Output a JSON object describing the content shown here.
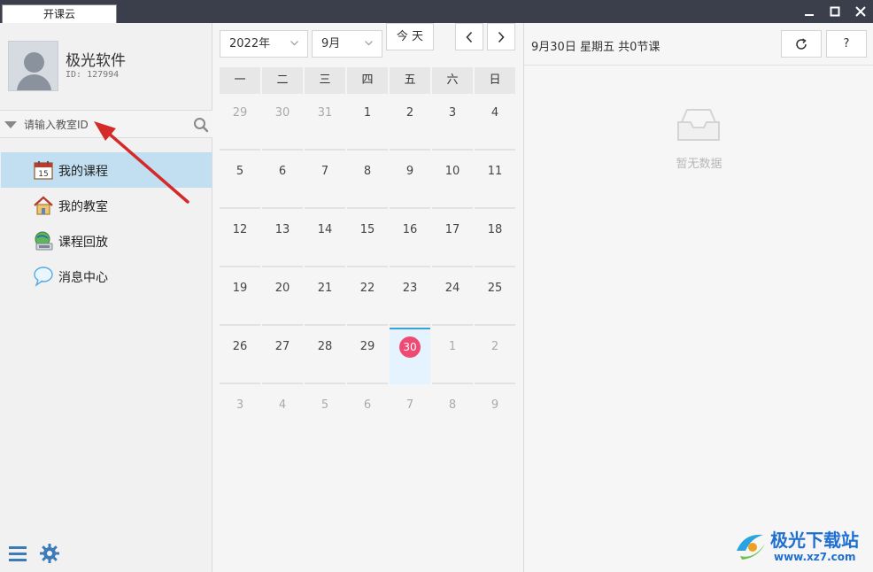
{
  "window": {
    "tab_title": "开课云",
    "minimize": "▁",
    "maximize": "☐",
    "close": "✕"
  },
  "user": {
    "name": "极光软件",
    "id_text": "ID: 127994"
  },
  "search": {
    "placeholder": "请输入教室ID"
  },
  "nav": [
    {
      "label": "我的课程",
      "icon": "calendar-icon",
      "active": true
    },
    {
      "label": "我的教室",
      "icon": "house-icon",
      "active": false
    },
    {
      "label": "课程回放",
      "icon": "playback-icon",
      "active": false
    },
    {
      "label": "消息中心",
      "icon": "message-icon",
      "active": false
    }
  ],
  "calendar": {
    "year_select": "2022年",
    "month_select": "9月",
    "today_button": "今 天",
    "prev": "<",
    "next": ">",
    "weekdays": [
      "一",
      "二",
      "三",
      "四",
      "五",
      "六",
      "日"
    ],
    "weeks": [
      [
        "29",
        "30",
        "31",
        "1",
        "2",
        "3",
        "4"
      ],
      [
        "5",
        "6",
        "7",
        "8",
        "9",
        "10",
        "11"
      ],
      [
        "12",
        "13",
        "14",
        "15",
        "16",
        "17",
        "18"
      ],
      [
        "19",
        "20",
        "21",
        "22",
        "23",
        "24",
        "25"
      ],
      [
        "26",
        "27",
        "28",
        "29",
        "30",
        "1",
        "2"
      ],
      [
        "3",
        "4",
        "5",
        "6",
        "7",
        "8",
        "9"
      ]
    ],
    "selected_day": "30",
    "accent_color": "#ef4a74"
  },
  "right_panel": {
    "header": "9月30日 星期五 共0节课",
    "refresh": "↻",
    "help": "?",
    "empty_text": "暂无数据"
  },
  "watermark": {
    "name": "极光下载站",
    "url": "www.xz7.com"
  }
}
